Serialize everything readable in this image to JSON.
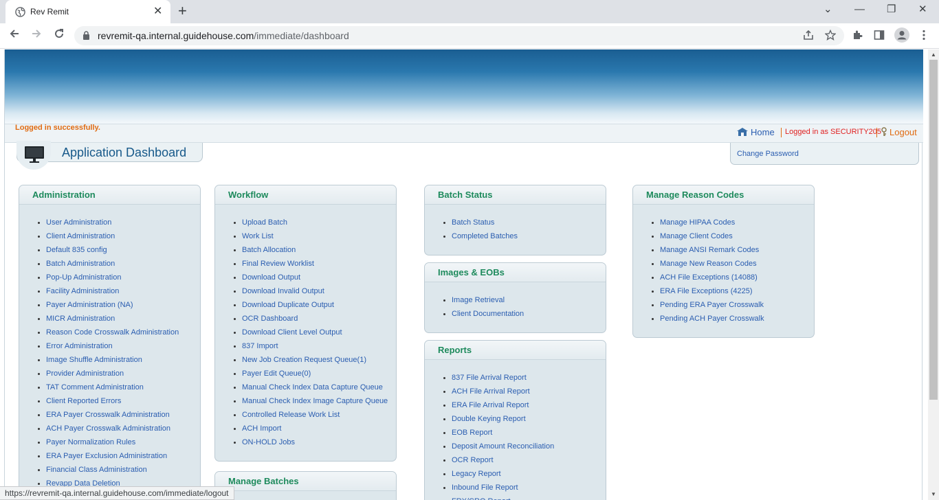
{
  "browser": {
    "tab_title": "Rev Remit",
    "tab_close": "✕",
    "new_tab": "+",
    "minimize": "⌄",
    "win_min": "—",
    "win_restore": "❐",
    "win_close": "✕",
    "url_host": "revremit-qa.internal.guidehouse.com",
    "url_path": "/immediate/dashboard",
    "status_url": "https://revremit-qa.internal.guidehouse.com/immediate/logout"
  },
  "header": {
    "login_message": "Logged in successfully.",
    "home": "Home",
    "logged_in_as": "Logged in as SECURITY205",
    "logout": "Logout",
    "dashboard_title": "Application Dashboard",
    "change_password": "Change Password"
  },
  "panels": {
    "administration": {
      "title": "Administration",
      "items": [
        "User Administration",
        "Client Administration",
        "Default 835 config",
        "Batch Administration",
        "Pop-Up Administration",
        "Facility Administration",
        "Payer Administration (NA)",
        "MICR Administration",
        "Reason Code Crosswalk Administration",
        "Error Administration",
        "Image Shuffle Administration",
        "Provider Administration",
        "TAT Comment Administration",
        "Client Reported Errors",
        "ERA Payer Crosswalk Administration",
        "ACH Payer Crosswalk Administration",
        "Payer Normalization Rules",
        "ERA Payer Exclusion Administration",
        "Financial Class Administration",
        "Revapp Data Deletion"
      ]
    },
    "workflow": {
      "title": "Workflow",
      "items": [
        "Upload Batch",
        "Work List",
        "Batch Allocation",
        "Final Review Worklist",
        "Download Output",
        "Download Invalid Output",
        "Download Duplicate Output",
        "OCR Dashboard",
        "Download Client Level Output",
        "837 Import",
        "New Job Creation Request Queue(1)",
        "Payer Edit Queue(0)",
        "Manual Check Index Data Capture Queue",
        "Manual Check Index Image Capture Queue",
        "Controlled Release Work List",
        "ACH Import",
        "ON-HOLD Jobs"
      ]
    },
    "manage_batches": {
      "title": "Manage Batches"
    },
    "batch_status": {
      "title": "Batch Status",
      "items": [
        "Batch Status",
        "Completed Batches"
      ]
    },
    "images_eobs": {
      "title": "Images & EOBs",
      "items": [
        "Image Retrieval",
        "Client Documentation"
      ]
    },
    "reports": {
      "title": "Reports",
      "items": [
        "837 File Arrival Report",
        "ACH File Arrival Report",
        "ERA File Arrival Report",
        "Double Keying Report",
        "EOB Report",
        "Deposit Amount Reconciliation",
        "OCR Report",
        "Legacy Report",
        "Inbound File Report",
        "FRX/CRO Report"
      ]
    },
    "reason_codes": {
      "title": "Manage Reason Codes",
      "items": [
        "Manage HIPAA Codes",
        "Manage Client Codes",
        "Manage ANSI Remark Codes",
        "Manage New Reason Codes",
        "ACH File Exceptions (14088)",
        "ERA File Exceptions (4225)",
        "Pending ERA Payer Crosswalk",
        "Pending ACH Payer Crosswalk"
      ]
    }
  }
}
